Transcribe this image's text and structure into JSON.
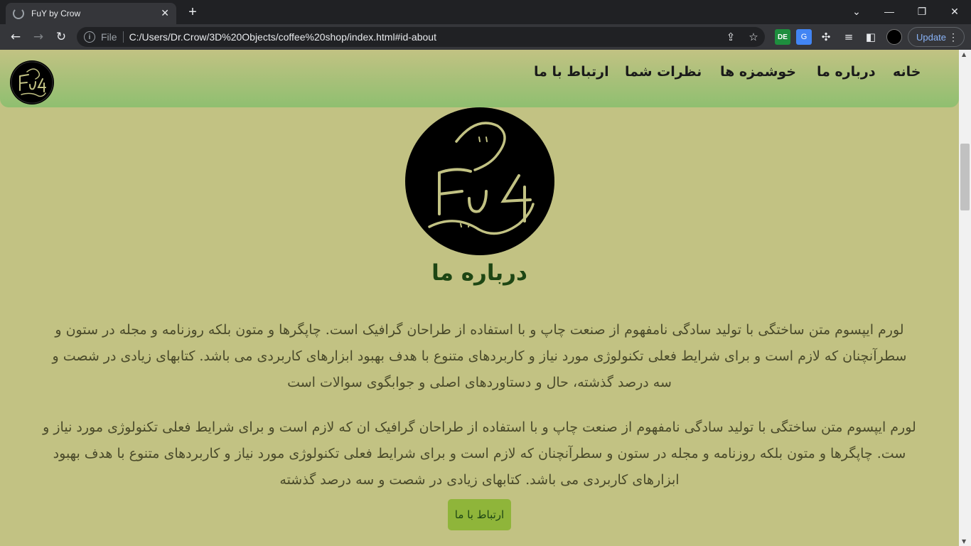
{
  "browser": {
    "tab_title": "FuY by Crow",
    "tab_close": "✕",
    "new_tab": "+",
    "window_min": "—",
    "window_max": "❐",
    "window_close": "✕",
    "minimize_chevron": "⌄",
    "address": {
      "scheme_label": "File",
      "url": "C:/Users/Dr.Crow/3D%20Objects/coffee%20shop/index.html#id-about"
    },
    "update_label": "Update",
    "menu_dots": "⋮"
  },
  "site": {
    "nav": {
      "home": "خانه",
      "about": "درباره ما",
      "treats": "خوشمزه ها",
      "reviews": "نظرات شما",
      "contact": "ارتباط با ما"
    },
    "logo_text": "FuY",
    "about": {
      "title": "درباره ما",
      "paragraph_1": "لورم ایپسوم متن ساختگی با تولید سادگی نامفهوم از صنعت چاپ و با استفاده از طراحان گرافیک است. چاپگرها و متون بلکه روزنامه و مجله در ستون و سطرآنچنان که لازم است و برای شرایط فعلی تکنولوژی مورد نیاز و کاربردهای متنوع با هدف بهبود ابزارهای کاربردی می باشد. کتابهای زیادی در شصت و سه درصد گذشته، حال و دستاوردهای اصلی و جوابگوی سوالات است",
      "paragraph_2": "لورم ایپسوم متن ساختگی با تولید سادگی نامفهوم از صنعت چاپ و با استفاده از طراحان گرافیک ان که لازم است و برای شرایط فعلی تکنولوژی مورد نیاز و ست. چاپگرها و متون بلکه روزنامه و مجله در ستون و سطرآنچنان که لازم است و برای شرایط فعلی تکنولوژی مورد نیاز و کاربردهای متنوع با هدف بهبود ابزارهای کاربردی می باشد. کتابهای زیادی در شصت و سه درصد گذشته",
      "contact_button": "ارتباط با ما"
    }
  },
  "colors": {
    "page_bg": "#c2c283",
    "header_gradient_end": "#8fbf70",
    "title": "#1e4614",
    "button_bg": "#8fb53a"
  },
  "icons": [
    "back-icon",
    "forward-icon",
    "reload-icon",
    "info-icon",
    "share-icon",
    "star-icon",
    "extension-de-icon",
    "translate-icon",
    "puzzle-icon",
    "media-icon",
    "sidebar-icon",
    "profile-avatar"
  ]
}
